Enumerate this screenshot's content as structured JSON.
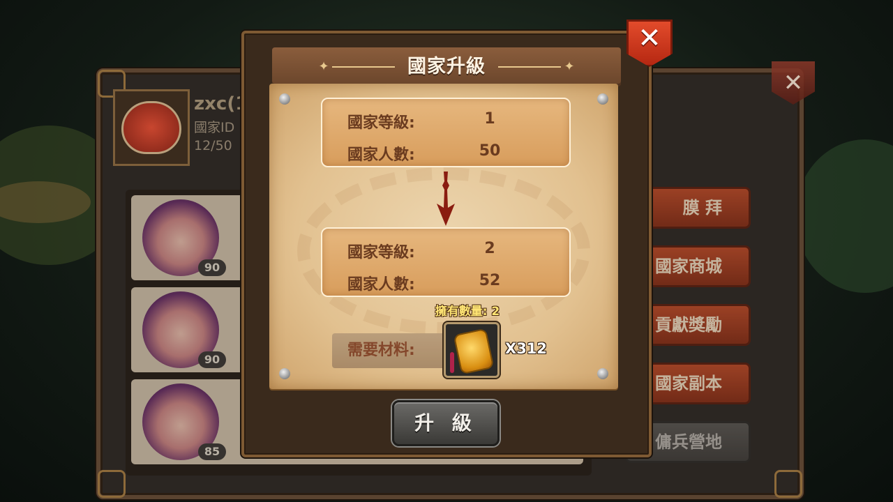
{
  "background": {
    "nation_name": "zxc(1",
    "nation_id_label": "國家ID",
    "member_count": "12/50",
    "members": [
      {
        "level": "90"
      },
      {
        "level": "90"
      },
      {
        "level": "85"
      }
    ],
    "side_menu": [
      "膜 拜",
      "國家商城",
      "貢獻獎勵",
      "國家副本",
      "傭兵營地"
    ]
  },
  "dialog": {
    "title": "國家升級",
    "close_icon": "✕",
    "current": {
      "level_label": "國家等級:",
      "level_value": "1",
      "population_label": "國家人數:",
      "population_value": "50"
    },
    "next": {
      "level_label": "國家等級:",
      "level_value": "2",
      "population_label": "國家人數:",
      "population_value": "52"
    },
    "owned_label": "擁有數量: 2",
    "material_label": "需要材料:",
    "material_icon": "gold-token-icon",
    "material_qty": "X312",
    "upgrade_button": "升 級"
  },
  "colors": {
    "dialog_close": "#d43a1d",
    "title_bar": "#7a5034",
    "stat_text": "#6a3b1f",
    "arrow": "#8a1c10",
    "owned_text": "#ffe574"
  }
}
